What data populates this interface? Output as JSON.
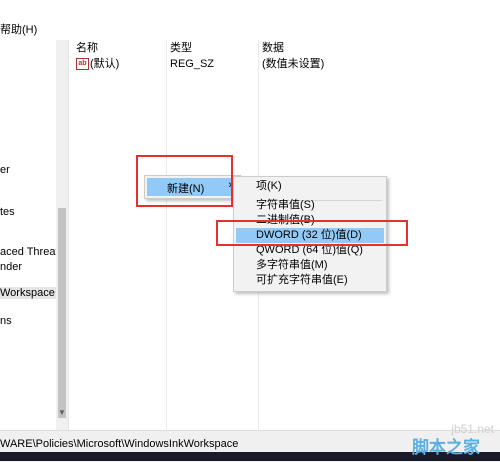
{
  "menubar": {
    "help": "帮助(H)"
  },
  "tree": {
    "items": [
      "er",
      "tes",
      "aced Threat P",
      "nder",
      "Workspace",
      "ns"
    ]
  },
  "list": {
    "headers": {
      "name": "名称",
      "type": "类型",
      "data": "数据"
    },
    "rows": [
      {
        "icon": "ab",
        "name": "(默认)",
        "type": "REG_SZ",
        "data": "(数值未设置)"
      }
    ]
  },
  "context_menu": {
    "new_label": "新建(N)",
    "new_arrow": "›"
  },
  "submenu": {
    "items": [
      "项(K)",
      "字符串值(S)",
      "二进制值(B)",
      "DWORD (32 位)值(D)",
      "QWORD (64 位)值(Q)",
      "多字符串值(M)",
      "可扩充字符串值(E)"
    ]
  },
  "statusbar": {
    "path": "WARE\\Policies\\Microsoft\\WindowsInkWorkspace"
  },
  "watermark": {
    "url": "jb51.net",
    "brand": "脚本之家"
  },
  "colors": {
    "highlight": "#91c9f7",
    "annotation": "#e63030"
  }
}
